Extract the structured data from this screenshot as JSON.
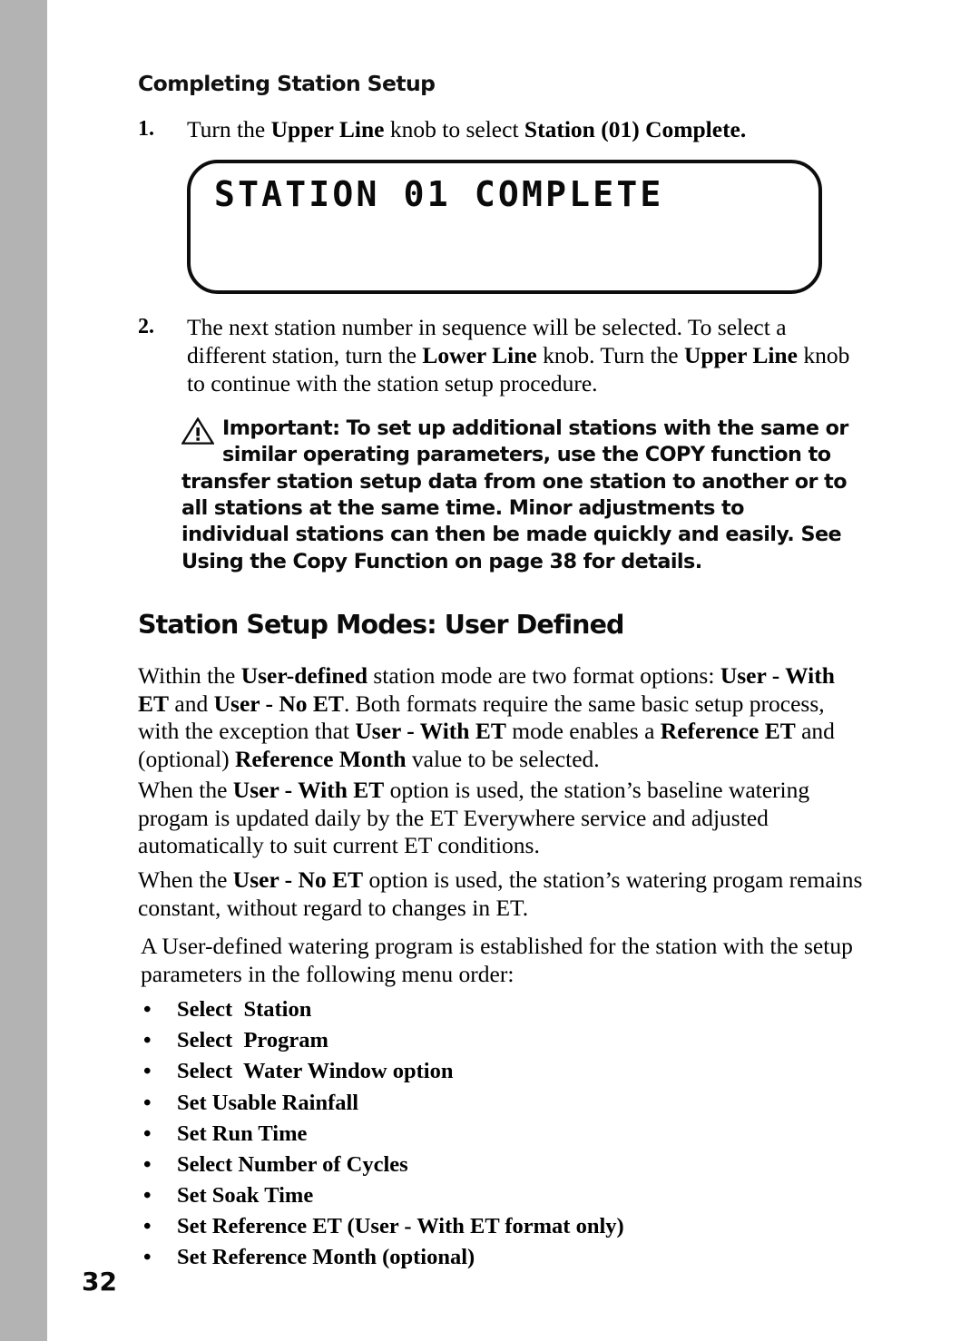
{
  "page": {
    "number": "32",
    "gutter_color": "#b3b3b3"
  },
  "kicker_heading": "Completing Station Setup",
  "steps": [
    {
      "number": "1.",
      "segments": [
        {
          "text": "Turn the ",
          "bold": false
        },
        {
          "text": "Upper Line",
          "bold": true
        },
        {
          "text": " knob to select ",
          "bold": false
        },
        {
          "text": "Station (01) Complete.",
          "bold": true
        }
      ]
    },
    {
      "number": "2.",
      "segments": [
        {
          "text": "The next station number in sequence will be selected. To select a different station, turn the ",
          "bold": false
        },
        {
          "text": "Lower Line",
          "bold": true
        },
        {
          "text": " knob. Turn the ",
          "bold": false
        },
        {
          "text": "Upper Line",
          "bold": true
        },
        {
          "text": " knob to continue with the station setup procedure.",
          "bold": false
        }
      ]
    }
  ],
  "lcd": {
    "icon": "lcd-screen",
    "line_1": "STATION 01 COMPLETE",
    "line_2": ""
  },
  "important_callout": {
    "icon": "warning-triangle-icon",
    "text": "Important: To set up additional stations with the same or similar operating parameters, use the COPY function to transfer station setup data from one station to another or to all stations at the same time. Minor adjustments to individual stations can then be made quickly and easily. See Using the Copy Function on page 38 for details."
  },
  "section_heading": "Station Setup Modes: User Defined",
  "paragraphs": [
    {
      "id": "para-1",
      "segments": [
        {
          "text": "Within the ",
          "bold": false
        },
        {
          "text": "User-defined",
          "bold": true
        },
        {
          "text": " station mode are two format options: ",
          "bold": false
        },
        {
          "text": "User - With ET",
          "bold": true
        },
        {
          "text": " and ",
          "bold": false
        },
        {
          "text": "User - No ET",
          "bold": true
        },
        {
          "text": ". Both formats require the same basic setup process, with the exception that  ",
          "bold": false
        },
        {
          "text": "User - With ET",
          "bold": true
        },
        {
          "text": " mode enables a ",
          "bold": false
        },
        {
          "text": "Reference ET",
          "bold": true
        },
        {
          "text": " and (optional) ",
          "bold": false
        },
        {
          "text": "Reference Month",
          "bold": true
        },
        {
          "text": " value to be selected.",
          "bold": false
        }
      ]
    },
    {
      "id": "para-2",
      "segments": [
        {
          "text": "When the ",
          "bold": false
        },
        {
          "text": "User - With ET",
          "bold": true
        },
        {
          "text": " option is used, the station’s baseline watering progam is updated daily by the ET Everywhere service and adjusted automatically to suit current ET conditions.",
          "bold": false
        }
      ]
    },
    {
      "id": "para-3",
      "segments": [
        {
          "text": "When the ",
          "bold": false
        },
        {
          "text": "User - No ET",
          "bold": true
        },
        {
          "text": " option is used, the station’s watering progam remains constant, without regard to changes in ET.",
          "bold": false
        }
      ]
    },
    {
      "id": "para-4",
      "segments": [
        {
          "text": "A User-defined watering program is established for the station with the setup parameters in the following menu order:",
          "bold": false
        }
      ]
    }
  ],
  "param_list": {
    "bullet_glyph": "•",
    "items": [
      "Select  Station",
      "Select  Program",
      "Select  Water Window option",
      "Set Usable Rainfall",
      "Set Run Time",
      "Select Number of Cycles",
      "Set Soak Time",
      "Set Reference ET (User - With ET format only)",
      "Set Reference Month (optional)"
    ]
  }
}
